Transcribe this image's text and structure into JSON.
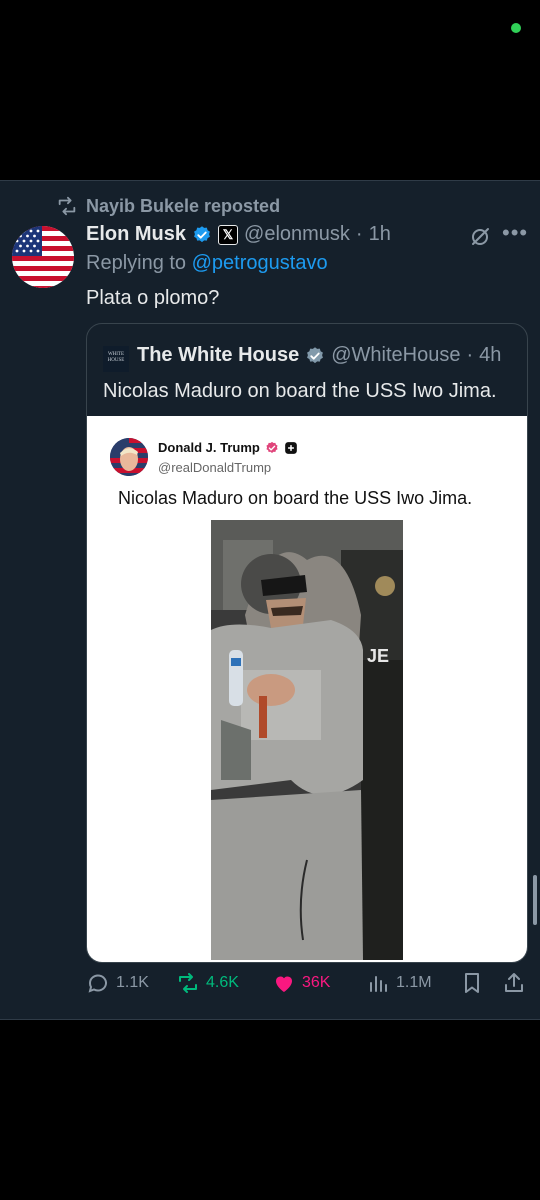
{
  "repost": {
    "label": "Nayib Bukele reposted"
  },
  "tweet": {
    "author_name": "Elon Musk",
    "author_handle": "@elonmusk",
    "separator": "·",
    "time": "1h",
    "replying_prefix": "Replying to",
    "replying_mention": "@petrogustavo",
    "text": "Plata o plomo?"
  },
  "quote": {
    "author_name": "The White House",
    "author_handle": "@WhiteHouse",
    "separator": "·",
    "time": "4h",
    "avatar_text": "WHITE HOUSE",
    "text": "Nicolas Maduro on board the USS Iwo Jima.",
    "embedded": {
      "author_name": "Donald J. Trump",
      "author_handle": "@realDonaldTrump",
      "text": "Nicolas Maduro on board the USS Iwo Jima."
    }
  },
  "actions": {
    "replies": "1.1K",
    "reposts": "4.6K",
    "likes": "36K",
    "views": "1.1M"
  },
  "colors": {
    "background": "#15202b",
    "accent": "#1d9bf0",
    "repost_green": "#00ba7c",
    "like_pink": "#f91880",
    "secondary_text": "#8b98a5"
  },
  "icons": [
    "repost-icon",
    "verified-icon",
    "x-logo-icon",
    "grok-icon",
    "more-icon",
    "reply-icon",
    "like-icon",
    "views-icon",
    "bookmark-icon",
    "share-icon"
  ]
}
